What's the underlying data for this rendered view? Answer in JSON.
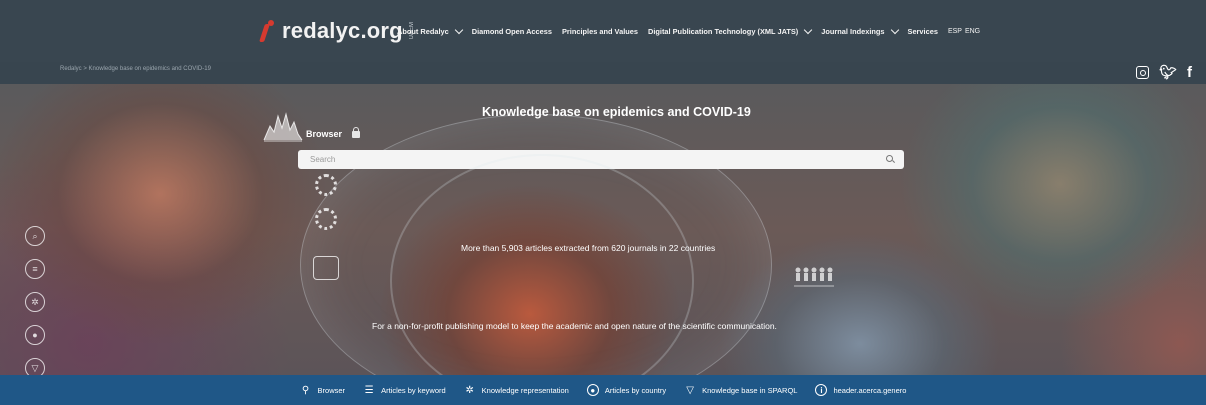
{
  "header": {
    "logo_text": "redalyc.org",
    "logo_sub": "UAEM",
    "nav": [
      {
        "label": "About Redalyc",
        "dropdown": true
      },
      {
        "label": "Diamond Open Access",
        "dropdown": false
      },
      {
        "label": "Principles and Values",
        "dropdown": false
      },
      {
        "label": "Digital Publication Technology (XML JATS)",
        "dropdown": true
      },
      {
        "label": "Journal Indexings",
        "dropdown": true
      },
      {
        "label": "Services",
        "dropdown": false
      }
    ],
    "lang": {
      "esp": "ESP",
      "eng": "ENG"
    }
  },
  "breadcrumb": "Redalyc > Knowledge base on epidemics and COVID-19",
  "social": {
    "icons": [
      "instagram-icon",
      "twitter-icon",
      "facebook-icon"
    ]
  },
  "hero": {
    "title": "Knowledge base on epidemics and COVID-19",
    "browser_label": "Browser",
    "search_placeholder": "Search",
    "stat": "More than 5,903 articles extracted from 620 journals in 22 countries",
    "tagline": "For a non-for-profit publishing model to keep the academic and open nature of the scientific communication."
  },
  "bottom_nav": [
    {
      "label": "Browser",
      "icon": "search-icon"
    },
    {
      "label": "Articles by keyword",
      "icon": "list-icon"
    },
    {
      "label": "Knowledge representation",
      "icon": "network-icon"
    },
    {
      "label": "Articles by country",
      "icon": "globe-icon"
    },
    {
      "label": "Knowledge base in SPARQL",
      "icon": "triangle-icon"
    },
    {
      "label": "header.acerca.genero",
      "icon": "info-icon"
    }
  ],
  "colors": {
    "topbar": "#394650",
    "bottombar": "#1f5787",
    "logo_accent": "#d63a2f"
  }
}
